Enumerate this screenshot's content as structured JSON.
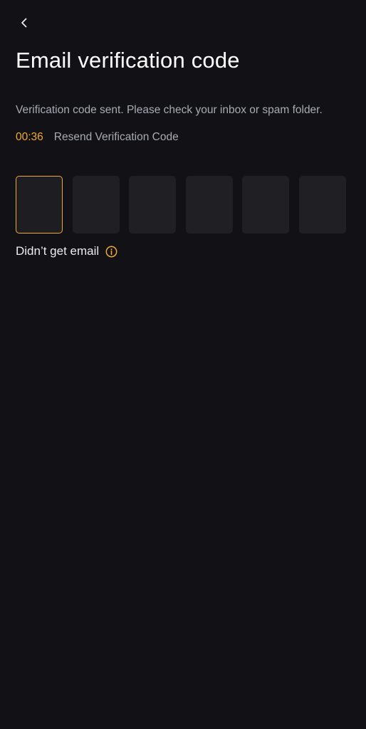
{
  "header": {
    "back_icon": "chevron-left-icon",
    "title": "Email verification code"
  },
  "instruction": "Verification code sent. Please check your inbox or spam folder.",
  "resend": {
    "countdown": "00:36",
    "label": "Resend Verification Code"
  },
  "code_input": {
    "digit_count": 6,
    "active_index": 0,
    "values": [
      "",
      "",
      "",
      "",
      "",
      ""
    ]
  },
  "help": {
    "label": "Didn’t get email",
    "icon": "info-icon"
  },
  "colors": {
    "background": "#121216",
    "accent": "#f0a935",
    "box_fill": "#1f1f24",
    "secondary_text": "#a7abb3",
    "primary_text": "#eaecef"
  }
}
